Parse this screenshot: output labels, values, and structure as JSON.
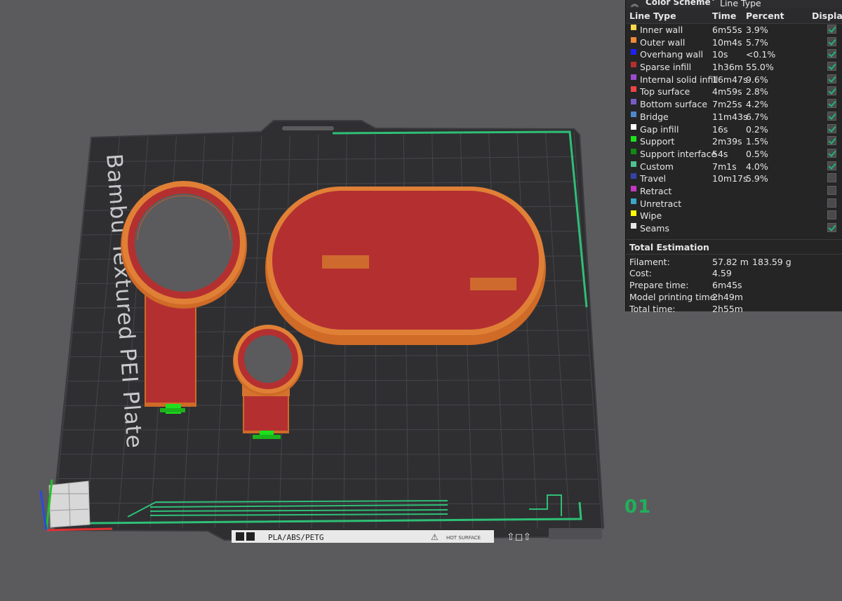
{
  "viewport": {
    "plate_name": "Bambu Textured PEI Plate",
    "plate_number": "01",
    "bottom_label": "PLA/ABS/PETG",
    "hot_surface": "HOT SURFACE"
  },
  "legend": {
    "collapse_icon": "double-chevron-up-icon",
    "scheme_title": "Color Scheme",
    "scheme_value": "Line Type",
    "columns": [
      "Line Type",
      "Time",
      "Percent",
      "Display"
    ],
    "rows": [
      {
        "name": "Inner wall",
        "time": "6m55s",
        "percent": "3.9%",
        "color": "#ffd74a",
        "display": true
      },
      {
        "name": "Outer wall",
        "time": "10m4s",
        "percent": "5.7%",
        "color": "#f08a37",
        "display": true
      },
      {
        "name": "Overhang wall",
        "time": "10s",
        "percent": "<0.1%",
        "color": "#2020ff",
        "display": true
      },
      {
        "name": "Sparse infill",
        "time": "1h36m",
        "percent": "55.0%",
        "color": "#b43030",
        "display": true
      },
      {
        "name": "Internal solid infill",
        "time": "16m47s",
        "percent": "9.6%",
        "color": "#9a4ccf",
        "display": true
      },
      {
        "name": "Top surface",
        "time": "4m59s",
        "percent": "2.8%",
        "color": "#f04444",
        "display": true
      },
      {
        "name": "Bottom surface",
        "time": "7m25s",
        "percent": "4.2%",
        "color": "#7a5cc8",
        "display": true
      },
      {
        "name": "Bridge",
        "time": "11m43s",
        "percent": "6.7%",
        "color": "#4f86c9",
        "display": true
      },
      {
        "name": "Gap infill",
        "time": "16s",
        "percent": "0.2%",
        "color": "#ffffff",
        "display": true
      },
      {
        "name": "Support",
        "time": "2m39s",
        "percent": "1.5%",
        "color": "#1ee01e",
        "display": true
      },
      {
        "name": "Support interface",
        "time": "54s",
        "percent": "0.5%",
        "color": "#138a13",
        "display": true
      },
      {
        "name": "Custom",
        "time": "7m1s",
        "percent": "4.0%",
        "color": "#4ec290",
        "display": true
      },
      {
        "name": "Travel",
        "time": "10m17s",
        "percent": "5.9%",
        "color": "#3543a8",
        "display": false
      },
      {
        "name": "Retract",
        "time": "",
        "percent": "",
        "color": "#c338c3",
        "display": false
      },
      {
        "name": "Unretract",
        "time": "",
        "percent": "",
        "color": "#3ba6c9",
        "display": false
      },
      {
        "name": "Wipe",
        "time": "",
        "percent": "",
        "color": "#ffff00",
        "display": false
      },
      {
        "name": "Seams",
        "time": "",
        "percent": "",
        "color": "#e6e6e6",
        "display": true
      }
    ],
    "total": {
      "title": "Total Estimation",
      "filament_label": "Filament:",
      "filament_length": "57.82 m",
      "filament_weight": "183.59 g",
      "cost_label": "Cost:",
      "cost_value": "4.59",
      "prepare_label": "Prepare time:",
      "prepare_value": "6m45s",
      "model_label": "Model printing time:",
      "model_value": "2h49m",
      "total_label": "Total time:",
      "total_value": "2h55m"
    }
  },
  "colors": {
    "background": "#5b5b5e",
    "plate": "#2f2f32",
    "grid": "#4a4a4e",
    "accent_green": "#1fb05a",
    "infill_red": "#b43030",
    "wall_orange": "#d26a2a",
    "panel_bg": "#252526"
  }
}
